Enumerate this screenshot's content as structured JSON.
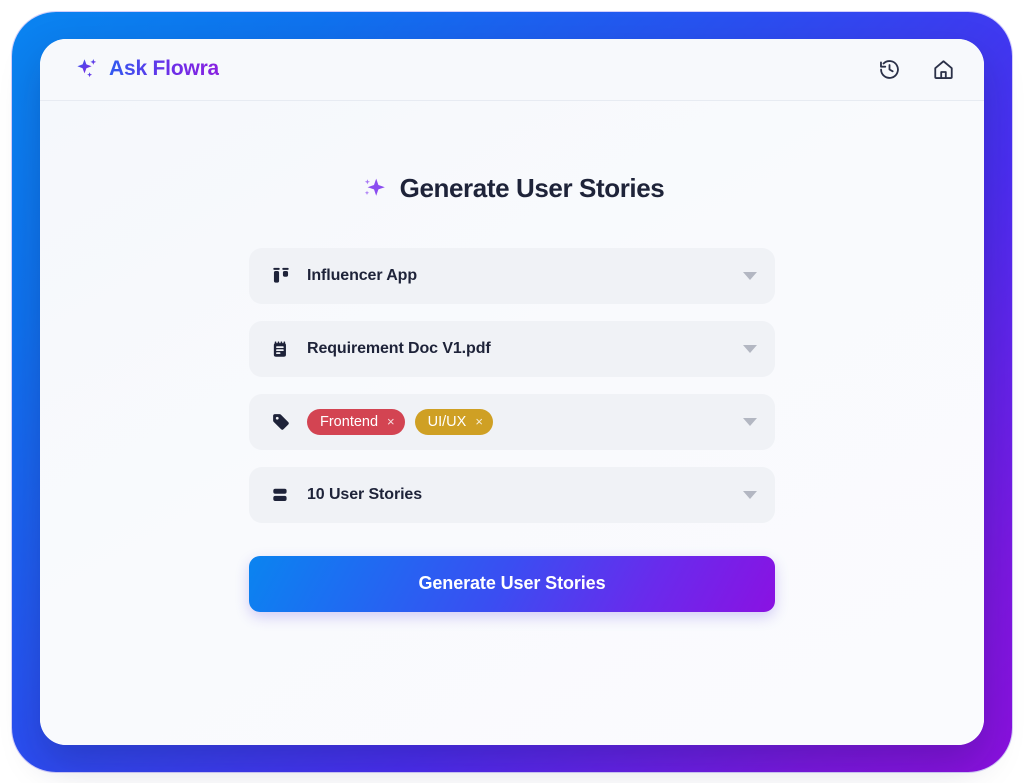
{
  "header": {
    "brand_name": "Ask Flowra",
    "brand_icon": "sparkles-icon",
    "actions": [
      {
        "name": "history-icon",
        "label": "History"
      },
      {
        "name": "home-icon",
        "label": "Home"
      }
    ]
  },
  "main": {
    "title": "Generate User Stories",
    "title_icon": "sparkle-icon",
    "fields": [
      {
        "name": "project-select",
        "icon": "project-board-icon",
        "value": "Influencer App",
        "caret": "chevron-down-icon"
      },
      {
        "name": "document-select",
        "icon": "notepad-document-icon",
        "value": "Requirement Doc V1.pdf",
        "caret": "chevron-down-icon"
      },
      {
        "name": "tags-select",
        "icon": "tag-icon",
        "caret": "chevron-down-icon",
        "chips": [
          {
            "label": "Frontend",
            "color": "#d34452",
            "remove": "×"
          },
          {
            "label": "UI/UX",
            "color": "#cfa024",
            "remove": "×"
          }
        ]
      },
      {
        "name": "count-select",
        "icon": "rows-stack-icon",
        "value": "10 User Stories",
        "caret": "chevron-down-icon"
      }
    ],
    "submit_label": "Generate User Stories"
  },
  "colors": {
    "brand_blue": "#2f5bf0",
    "brand_purple": "#8a21e0",
    "chip_red": "#d34452",
    "chip_gold": "#cfa024",
    "text_dark": "#1e2339",
    "field_bg": "#f0f2f6"
  }
}
